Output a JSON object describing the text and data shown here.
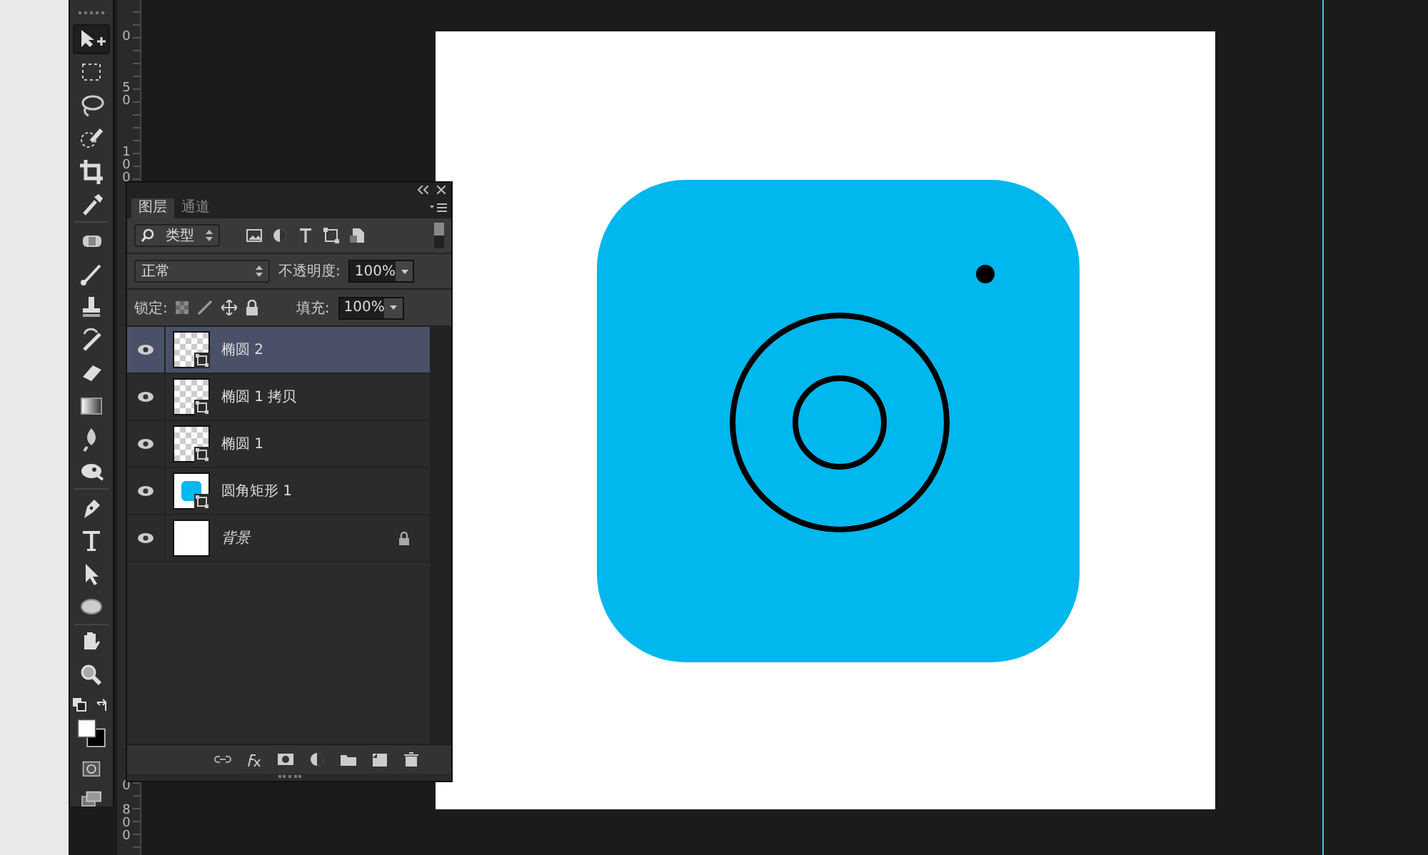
{
  "tools": [
    {
      "kind": "move",
      "selected": true
    },
    {
      "kind": "marquee",
      "selected": false
    },
    {
      "kind": "lasso",
      "selected": false
    },
    {
      "kind": "quick-select",
      "selected": false
    },
    {
      "kind": "crop",
      "selected": false
    },
    {
      "kind": "eyedropper",
      "selected": false
    },
    {
      "kind": "separator"
    },
    {
      "kind": "heal",
      "selected": false
    },
    {
      "kind": "brush",
      "selected": false
    },
    {
      "kind": "stamp",
      "selected": false
    },
    {
      "kind": "history-brush",
      "selected": false
    },
    {
      "kind": "eraser",
      "selected": false
    },
    {
      "kind": "gradient",
      "selected": false
    },
    {
      "kind": "blur",
      "selected": false
    },
    {
      "kind": "dodge",
      "selected": false
    },
    {
      "kind": "separator"
    },
    {
      "kind": "pen",
      "selected": false
    },
    {
      "kind": "type",
      "selected": false
    },
    {
      "kind": "path-select",
      "selected": false
    },
    {
      "kind": "ellipse",
      "selected": false
    },
    {
      "kind": "separator"
    },
    {
      "kind": "hand",
      "selected": false
    },
    {
      "kind": "zoom",
      "selected": false
    }
  ],
  "ruler": {
    "top_labels": [
      "0",
      "50",
      "100"
    ],
    "bottom_labels": [
      "0",
      "800"
    ]
  },
  "layers_panel": {
    "tabs": [
      {
        "label": "图层",
        "selected": true
      },
      {
        "label": "通道",
        "selected": false
      }
    ],
    "filter": {
      "value": "类型"
    },
    "blend_mode": {
      "value": "正常"
    },
    "opacity": {
      "label": "不透明度:",
      "value": "100%"
    },
    "lock": {
      "label": "锁定:"
    },
    "fill": {
      "label": "填充:",
      "value": "100%"
    },
    "layers": [
      {
        "name": "椭圆 2",
        "kind": "shape",
        "selected": true,
        "locked": false,
        "visible": true
      },
      {
        "name": "椭圆 1 拷贝",
        "kind": "shape",
        "selected": false,
        "locked": false,
        "visible": true
      },
      {
        "name": "椭圆 1",
        "kind": "shape",
        "selected": false,
        "locked": false,
        "visible": true
      },
      {
        "name": "圆角矩形 1",
        "kind": "rect-shape",
        "selected": false,
        "locked": false,
        "visible": true
      },
      {
        "name": "背景",
        "kind": "background",
        "selected": false,
        "locked": true,
        "visible": true
      }
    ]
  }
}
